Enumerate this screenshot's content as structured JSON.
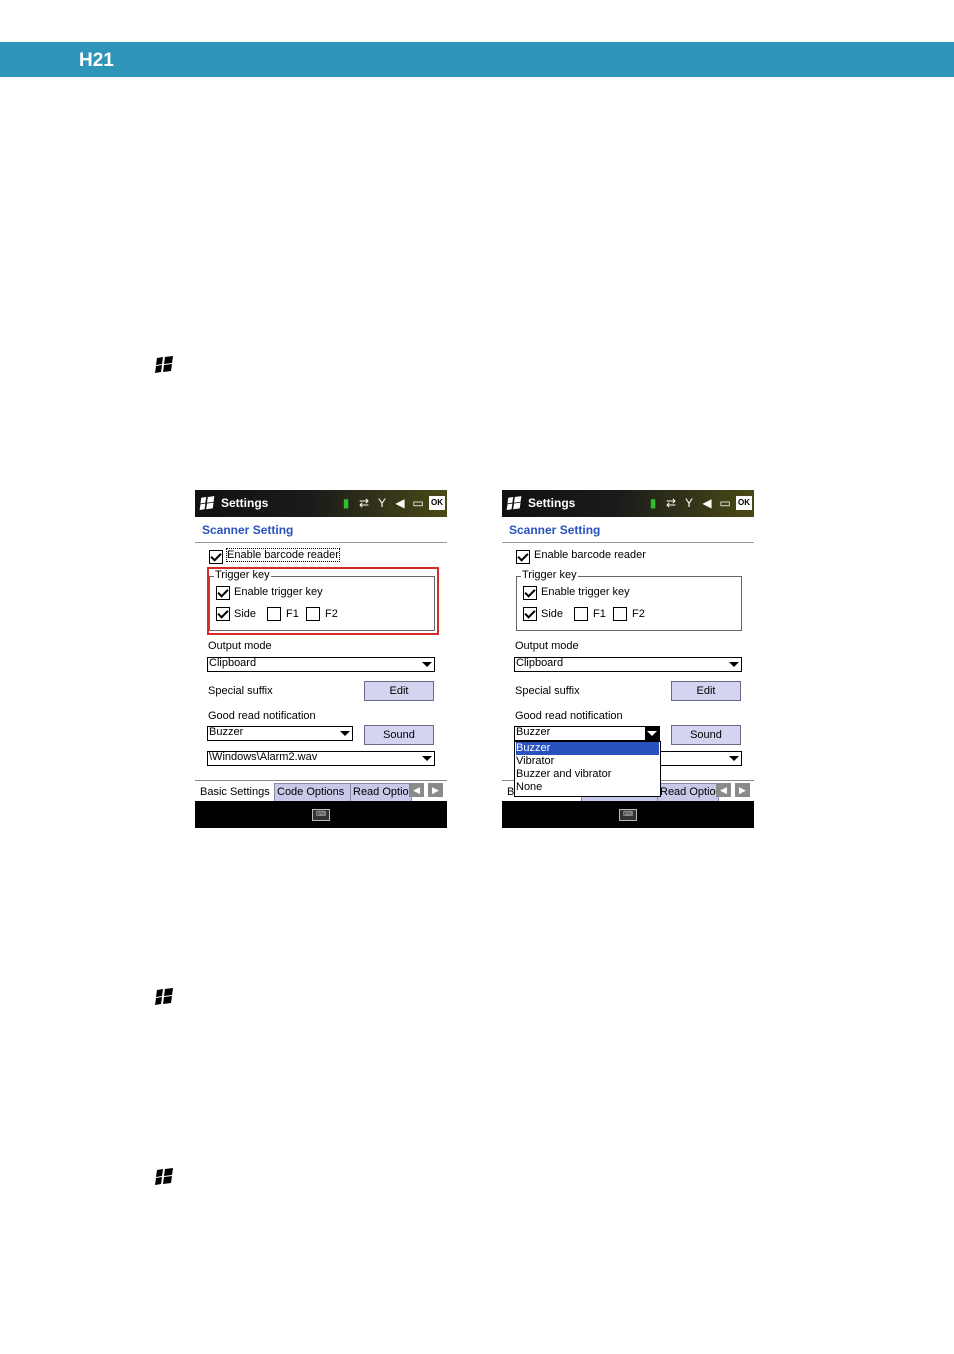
{
  "header": {
    "title": "H21"
  },
  "colors": {
    "header_bar": "#2f95b8",
    "highlight_box": "#d42a2a",
    "title_text": "#2a52be"
  },
  "icons": [
    "windows-start-icon"
  ],
  "screens": [
    {
      "titlebar": {
        "title": "Settings"
      },
      "page_title": "Scanner Setting",
      "enable_reader": {
        "label": "Enable barcode reader",
        "checked": true
      },
      "trigger_group": "Trigger key",
      "enable_trigger": {
        "label": "Enable trigger key",
        "checked": true
      },
      "side": {
        "label": "Side",
        "checked": true
      },
      "f1": {
        "label": "F1",
        "checked": false
      },
      "f2": {
        "label": "F2",
        "checked": false
      },
      "output_mode_label": "Output mode",
      "output_mode_value": "Clipboard",
      "special_suffix_label": "Special suffix",
      "edit_button": "Edit",
      "good_read_label": "Good read notification",
      "notification_value": "Buzzer",
      "sound_button": "Sound",
      "wav_path": "\\Windows\\Alarm2.wav",
      "tabs": [
        "Basic Settings",
        "Code Options",
        "Read Optio"
      ]
    },
    {
      "titlebar": {
        "title": "Settings"
      },
      "page_title": "Scanner Setting",
      "enable_reader": {
        "label": "Enable barcode reader",
        "checked": true
      },
      "trigger_group": "Trigger key",
      "enable_trigger": {
        "label": "Enable trigger key",
        "checked": true
      },
      "side": {
        "label": "Side",
        "checked": true
      },
      "f1": {
        "label": "F1",
        "checked": false
      },
      "f2": {
        "label": "F2",
        "checked": false
      },
      "output_mode_label": "Output mode",
      "output_mode_value": "Clipboard",
      "special_suffix_label": "Special suffix",
      "edit_button": "Edit",
      "good_read_label": "Good read notification",
      "notification_value": "Buzzer",
      "sound_button": "Sound",
      "tab_fragment_left": "B",
      "tab_right": "Read Optio",
      "dropdown_options": [
        "Buzzer",
        "Vibrator",
        "Buzzer and vibrator",
        "None"
      ],
      "dropdown_selected": "Buzzer"
    }
  ]
}
